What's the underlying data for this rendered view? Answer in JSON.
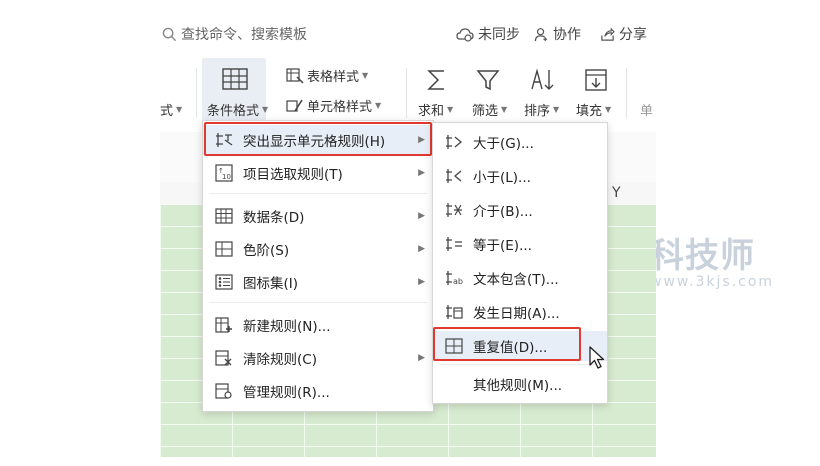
{
  "topbar": {
    "search": "查找命令、搜索模板",
    "sync": "未同步",
    "collab": "协作",
    "share": "分享"
  },
  "ribbon": {
    "left_partial": "式",
    "cond_format": "条件格式",
    "table_style": "表格样式",
    "cell_style": "单元格样式",
    "sum": "求和",
    "filter": "筛选",
    "sort": "排序",
    "fill": "填充",
    "right_partial": "单"
  },
  "sheet": {
    "col_y": "Y"
  },
  "menu": {
    "items": [
      {
        "label": "突出显示单元格规则(H)",
        "icon": "highlight-rules-icon",
        "arrow": true
      },
      {
        "label": "项目选取规则(T)",
        "icon": "top10-icon",
        "arrow": true
      },
      {
        "label": "数据条(D)",
        "icon": "data-bar-icon",
        "arrow": true
      },
      {
        "label": "色阶(S)",
        "icon": "color-scale-icon",
        "arrow": true
      },
      {
        "label": "图标集(I)",
        "icon": "icon-set-icon",
        "arrow": true
      },
      {
        "label": "新建规则(N)...",
        "icon": "new-rule-icon",
        "arrow": false
      },
      {
        "label": "清除规则(C)",
        "icon": "clear-rule-icon",
        "arrow": true
      },
      {
        "label": "管理规则(R)...",
        "icon": "manage-rule-icon",
        "arrow": false
      }
    ]
  },
  "submenu": {
    "items": [
      {
        "label": "大于(G)...",
        "icon": "greater-than-icon"
      },
      {
        "label": "小于(L)...",
        "icon": "less-than-icon"
      },
      {
        "label": "介于(B)...",
        "icon": "between-icon"
      },
      {
        "label": "等于(E)...",
        "icon": "equal-icon"
      },
      {
        "label": "文本包含(T)...",
        "icon": "text-contains-icon"
      },
      {
        "label": "发生日期(A)...",
        "icon": "date-occurring-icon"
      },
      {
        "label": "重复值(D)...",
        "icon": "duplicate-values-icon"
      },
      {
        "label": "其他规则(M)...",
        "icon": ""
      }
    ]
  },
  "watermark": {
    "title": "科技师",
    "url": "www.3kjs.com"
  },
  "colors": {
    "highlight_border": "#e0392f",
    "sheet_fill": "#d7ebd0",
    "hover": "#e8eef7"
  }
}
